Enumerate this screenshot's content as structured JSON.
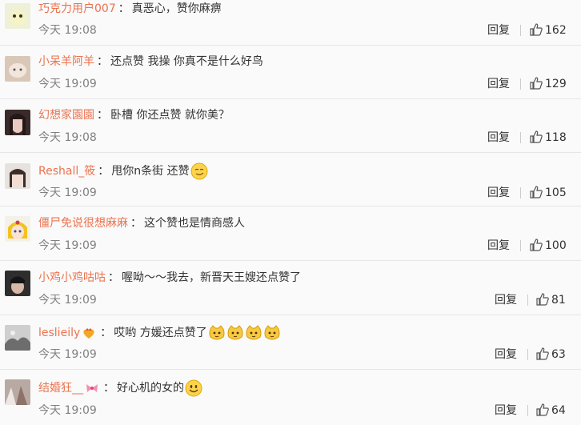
{
  "comments": [
    {
      "user": "巧克力用户007",
      "text": "真恶心，赞你麻痹",
      "time": "今天 19:08",
      "reply": "回复",
      "likes": "162",
      "badge": null,
      "emojis": 0
    },
    {
      "user": "小呆羊阿羊",
      "text": "还点赞 我操 你真不是什么好鸟",
      "time": "今天 19:09",
      "reply": "回复",
      "likes": "129",
      "badge": null,
      "emojis": 0
    },
    {
      "user": "幻想家園園",
      "text": "卧槽 你还点赞 就你美？",
      "time": "今天 19:08",
      "reply": "回复",
      "likes": "118",
      "badge": null,
      "emojis": 0
    },
    {
      "user": "Reshall_筱",
      "text": "甩你n条街 还赞",
      "time": "今天 19:09",
      "reply": "回复",
      "likes": "105",
      "badge": null,
      "emojis": 1
    },
    {
      "user": "僵尸免说很想麻麻",
      "text": "这个赞也是情商感人",
      "time": "今天 19:09",
      "reply": "回复",
      "likes": "100",
      "badge": null,
      "emojis": 0
    },
    {
      "user": "小鸡小鸡咕咕",
      "text": "喔呦～～我去，新晋天王嫂还点赞了",
      "time": "今天 19:09",
      "reply": "回复",
      "likes": "81",
      "badge": null,
      "emojis": 0
    },
    {
      "user": "leslieily",
      "text": "哎哟 方媛还点赞了",
      "time": "今天 19:09",
      "reply": "回复",
      "likes": "63",
      "badge": "crown-heart-icon",
      "emojis": 4
    },
    {
      "user": "结婚狂__",
      "text": "好心机的女的",
      "time": "今天 19:09",
      "reply": "回复",
      "likes": "64",
      "badge": "ribbon-icon",
      "emojis": 1
    }
  ],
  "separator": "：",
  "colors": {
    "username": "#eb7350",
    "time": "#808080",
    "text": "#333333",
    "divider": "#e6e6e6"
  }
}
